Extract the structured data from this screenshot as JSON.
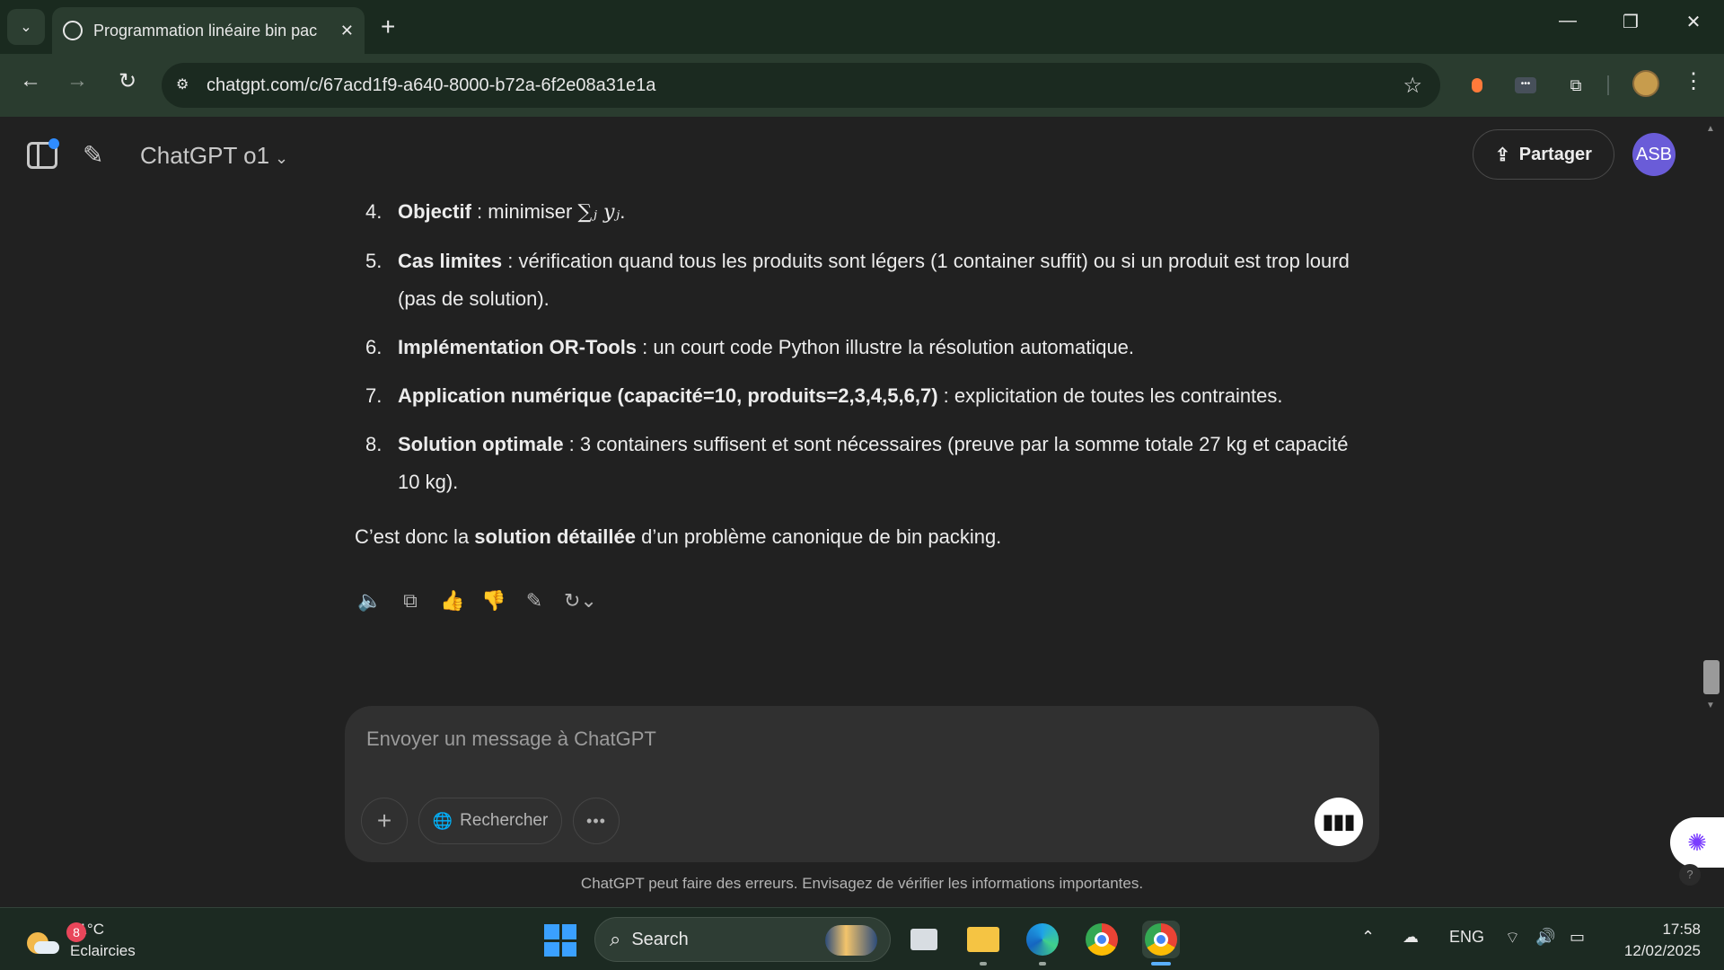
{
  "browser": {
    "tab_title": "Programmation linéaire bin pac",
    "url": "chatgpt.com/c/67acd1f9-a640-8000-b72a-6f2e08a31e1a"
  },
  "header": {
    "model_name": "ChatGPT o1",
    "share_label": "Partager",
    "avatar_initials": "ASB"
  },
  "message": {
    "items": [
      {
        "num": "4.",
        "bold": "Objectif",
        "text": " : minimiser ",
        "math": "∑ⱼ yⱼ",
        "suffix": "."
      },
      {
        "num": "5.",
        "bold": "Cas limites",
        "text": " : vérification quand tous les produits sont légers (1 container suffit) ou si un produit est trop lourd (pas de solution)."
      },
      {
        "num": "6.",
        "bold": "Implémentation OR-Tools",
        "text": " : un court code Python illustre la résolution automatique."
      },
      {
        "num": "7.",
        "bold": "Application numérique (capacité=10, produits=2,3,4,5,6,7)",
        "text": " : explicitation de toutes les contraintes."
      },
      {
        "num": "8.",
        "bold": "Solution optimale",
        "text": " : 3 containers suffisent et sont nécessaires (preuve par la somme totale 27 kg et capacité 10 kg)."
      }
    ],
    "summary_prefix": "C’est donc la ",
    "summary_bold": "solution détaillée",
    "summary_suffix": " d’un problème canonique de bin packing."
  },
  "composer": {
    "placeholder": "Envoyer un message à ChatGPT",
    "search_label": "Rechercher"
  },
  "disclaimer": "ChatGPT peut faire des erreurs. Envisagez de vérifier les informations importantes.",
  "taskbar": {
    "weather_temp": "31°C",
    "weather_desc": "Eclaircies",
    "weather_badge": "8",
    "search_label": "Search",
    "language": "ENG",
    "time": "17:58",
    "date": "12/02/2025"
  }
}
